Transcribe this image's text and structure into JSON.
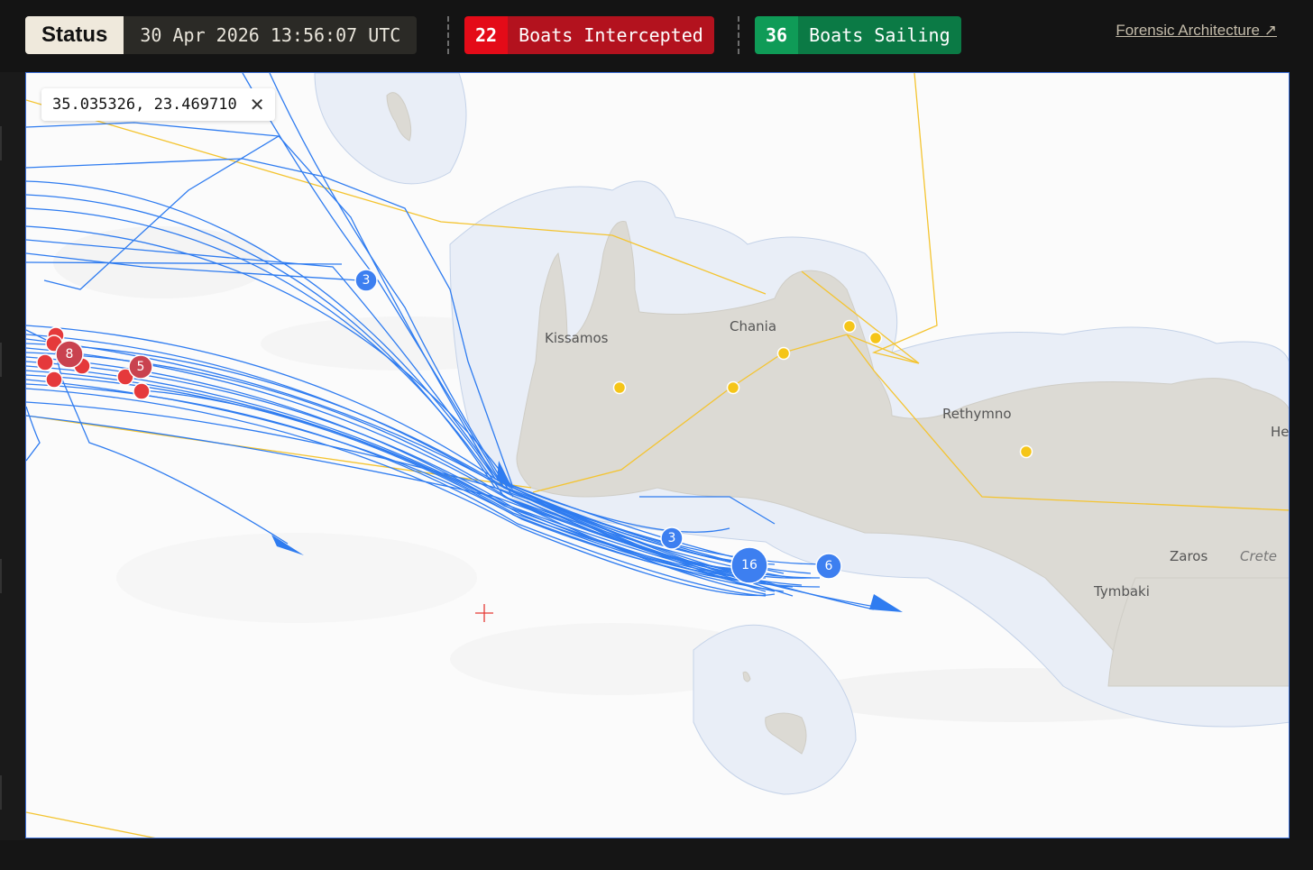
{
  "status": {
    "label": "Status",
    "timestamp": "30 Apr 2026 13:56:07 UTC"
  },
  "counters": {
    "intercepted": {
      "count": "22",
      "label": "Boats Intercepted",
      "color": "#e40b18"
    },
    "sailing": {
      "count": "36",
      "label": "Boats Sailing",
      "color": "#0f9b57"
    }
  },
  "external_link": {
    "label": "Forensic Architecture",
    "icon": "arrow-up-right-icon"
  },
  "coordinates": {
    "value": "35.035326, 23.469710",
    "close_icon": "close-icon"
  },
  "map": {
    "places": {
      "kissamos": "Kissamos",
      "chania": "Chania",
      "rethymno": "Rethymno",
      "zaros": "Zaros",
      "tymbaki": "Tymbaki",
      "crete": "Crete",
      "heraklion_partial": "He"
    },
    "clusters": {
      "blue_3_north": "3",
      "blue_3_south": "3",
      "blue_16": "16",
      "blue_6": "6",
      "red_8": "8",
      "red_5": "5"
    },
    "colors": {
      "track": "#2f7cf0",
      "sailing_cluster": "#3d7ff0",
      "intercept_cluster": "#e5393b",
      "intercept_cluster_dark": "#c9424f",
      "boundary": "#f4c430",
      "land": "#dcdad4"
    }
  }
}
